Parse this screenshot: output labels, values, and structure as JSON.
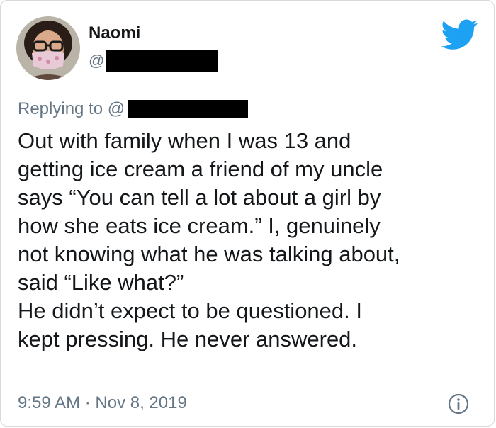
{
  "tweet": {
    "author": {
      "display_name": "Naomi",
      "handle_prefix": "@",
      "avatar_icon": "profile-avatar"
    },
    "reply": {
      "prefix": "Replying to @"
    },
    "body_lines": [
      "Out with family when I was 13 and",
      "getting ice cream a friend of my uncle",
      "says “You can tell a lot about a girl by",
      "how she eats ice cream.” I, genuinely",
      "not knowing what he was talking about,",
      "said “Like what?”",
      "He didn’t expect to be questioned. I",
      "kept pressing. He never answered."
    ],
    "timestamp": "9:59 AM · Nov 8, 2019",
    "brand_icon": "twitter-bird-icon",
    "info_icon": "info-icon",
    "colors": {
      "brand_blue": "#1da1f2",
      "secondary_text": "#657786",
      "primary_text": "#14171a"
    }
  }
}
